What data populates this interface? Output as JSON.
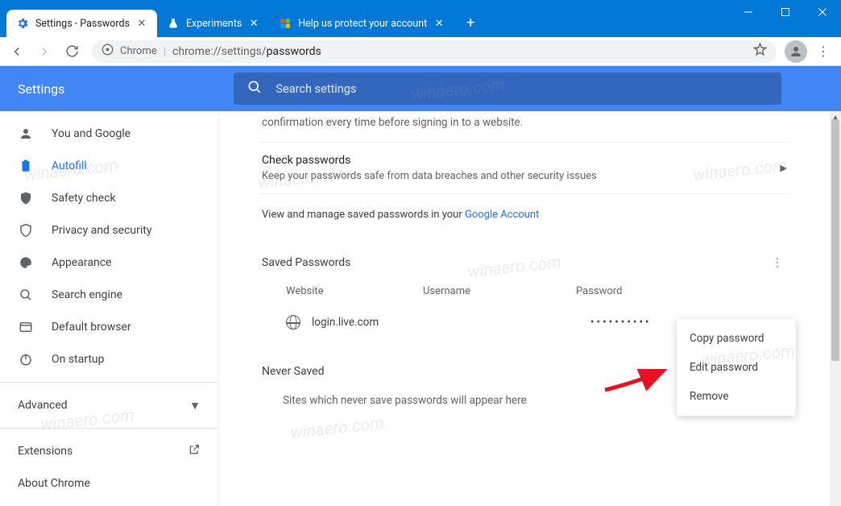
{
  "window": {
    "tabs": [
      {
        "title": "Settings - Passwords",
        "active": true
      },
      {
        "title": "Experiments",
        "active": false
      },
      {
        "title": "Help us protect your account",
        "active": false
      }
    ]
  },
  "toolbar": {
    "secure_label": "Chrome",
    "url_prefix": "chrome://settings/",
    "url_path": "passwords"
  },
  "settings": {
    "title": "Settings",
    "search_placeholder": "Search settings"
  },
  "sidebar": {
    "items": [
      {
        "label": "You and Google"
      },
      {
        "label": "Autofill"
      },
      {
        "label": "Safety check"
      },
      {
        "label": "Privacy and security"
      },
      {
        "label": "Appearance"
      },
      {
        "label": "Search engine"
      },
      {
        "label": "Default browser"
      },
      {
        "label": "On startup"
      }
    ],
    "advanced": "Advanced",
    "extensions": "Extensions",
    "about": "About Chrome"
  },
  "content": {
    "intro_tail": "confirmation every time before signing in to a website.",
    "check_title": "Check passwords",
    "check_sub": "Keep your passwords safe from data breaches and other security issues",
    "view_manage_prefix": "View and manage saved passwords in your ",
    "view_manage_link": "Google Account",
    "saved_header": "Saved Passwords",
    "cols": {
      "website": "Website",
      "username": "Username",
      "password": "Password"
    },
    "row": {
      "site": "login.live.com",
      "password_mask": "••••••••••"
    },
    "never_header": "Never Saved",
    "never_msg": "Sites which never save passwords will appear here"
  },
  "menu": {
    "copy": "Copy password",
    "edit": "Edit password",
    "remove": "Remove"
  },
  "watermark": "winaero.com"
}
